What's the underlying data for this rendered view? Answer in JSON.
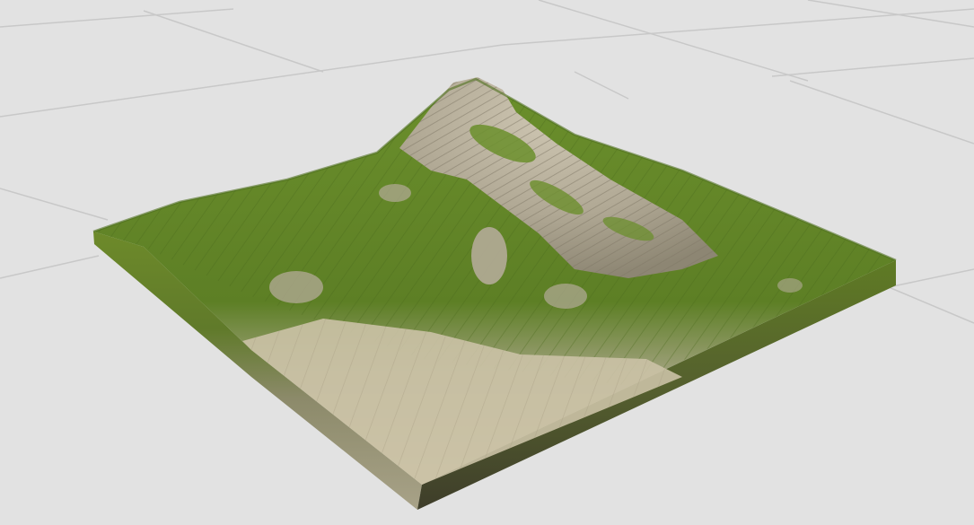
{
  "scene": {
    "background_color": "#e2e2e2",
    "grid_line_color": "#c8c8c8",
    "terrain": {
      "grass_color": "#6b8f2c",
      "grass_dark_color": "#4f6f1e",
      "rock_color": "#b4ab98",
      "sand_color": "#c9c0a4",
      "side_color": "#5c5a3a"
    }
  }
}
